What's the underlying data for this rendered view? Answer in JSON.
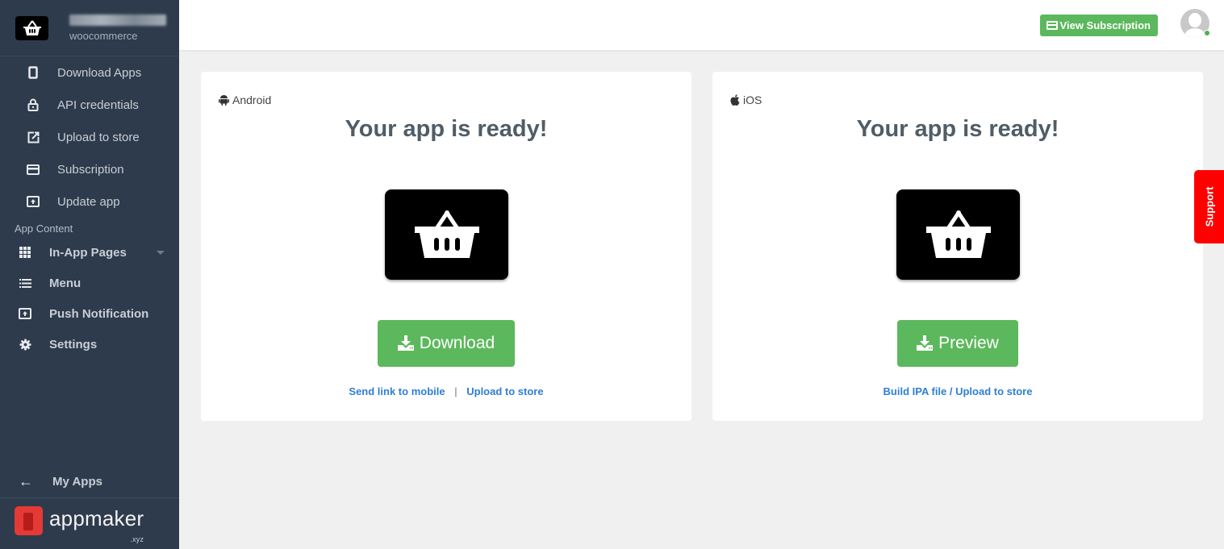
{
  "sidebar": {
    "brand": {
      "name_blurred": true,
      "subtitle": "woocommerce"
    },
    "items": [
      {
        "label": "Download Apps",
        "icon": "mobile-icon"
      },
      {
        "label": "API credentials",
        "icon": "lock-icon"
      },
      {
        "label": "Upload to store",
        "icon": "external-link-icon"
      },
      {
        "label": "Subscription",
        "icon": "credit-card-icon"
      },
      {
        "label": "Update app",
        "icon": "upload-box-icon"
      }
    ],
    "group_label": "App Content",
    "content_items": [
      {
        "label": "In-App Pages",
        "icon": "grid-icon",
        "has_submenu": true
      },
      {
        "label": "Menu",
        "icon": "list-icon"
      },
      {
        "label": "Push Notification",
        "icon": "upload-box-icon"
      },
      {
        "label": "Settings",
        "icon": "gear-icon"
      }
    ],
    "my_apps": "My Apps",
    "footer_logo": {
      "word": "appmaker",
      "suffix": ".xyz"
    }
  },
  "header": {
    "view_subscription": "View Subscription",
    "user_status": "online"
  },
  "cards": {
    "android": {
      "platform": "Android",
      "title": "Your app is ready!",
      "button": "Download",
      "link1": "Send link to mobile",
      "separator": "|",
      "link2": "Upload to store"
    },
    "ios": {
      "platform": "iOS",
      "title": "Your app is ready!",
      "button": "Preview",
      "link1": "Build IPA file / Upload to store"
    }
  },
  "support": "Support",
  "colors": {
    "sidebar_bg": "#2e3b4c",
    "accent_green": "#5cb85c",
    "link_blue": "#2f7fd3",
    "support_red": "#ff0000",
    "brand_red": "#e53935"
  }
}
